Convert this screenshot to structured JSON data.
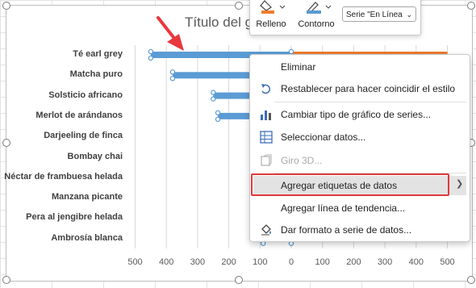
{
  "chart": {
    "title": "Título del g"
  },
  "chart_data": {
    "type": "bar",
    "categories": [
      "Té earl grey",
      "Matcha puro",
      "Solsticio africano",
      "Merlot de arándanos",
      "Darjeeling de finca",
      "Bombay chai",
      "Néctar de frambuesa helada",
      "Manzana picante",
      "Pera al jengibre helada",
      "Ambrosía blanca"
    ],
    "series": [
      {
        "values": [
          450,
          380,
          250,
          235,
          null,
          null,
          null,
          null,
          null,
          null
        ]
      },
      {
        "values": [
          500,
          null,
          null,
          null,
          null,
          null,
          null,
          null,
          null,
          90
        ]
      }
    ],
    "x_ticks": [
      "500",
      "400",
      "300",
      "200",
      "100",
      "0",
      "100",
      "200",
      "300",
      "400",
      "500"
    ],
    "xlim": [
      -500,
      500
    ],
    "colors": {
      "series1": "#5b9bd5",
      "series2": "#ed7d31"
    }
  },
  "toolbar": {
    "fill_label": "Relleno",
    "outline_label": "Contorno",
    "series_select": "Serie \"En Línea",
    "fill_icon": "paint-bucket-icon",
    "outline_icon": "pen-outline-icon"
  },
  "menu": {
    "items": [
      {
        "label": "Eliminar",
        "icon": "",
        "disabled": false
      },
      {
        "label": "Restablecer para hacer coincidir el estilo",
        "icon": "reset-style-icon",
        "disabled": false
      },
      {
        "label": "Cambiar tipo de gráfico de series...",
        "icon": "change-chart-type-icon",
        "disabled": false
      },
      {
        "label": "Seleccionar datos...",
        "icon": "select-data-icon",
        "disabled": false
      },
      {
        "label": "Giro 3D...",
        "icon": "rotate-3d-icon",
        "disabled": true
      },
      {
        "label": "Agregar etiquetas de datos",
        "icon": "",
        "disabled": false
      },
      {
        "label": "Agregar línea de tendencia...",
        "icon": "",
        "disabled": false
      },
      {
        "label": "Dar formato a serie de datos...",
        "icon": "format-series-icon",
        "disabled": false
      }
    ]
  },
  "annotation": {
    "arrow_color": "#e8383d",
    "highlight_color": "#e0393b"
  }
}
